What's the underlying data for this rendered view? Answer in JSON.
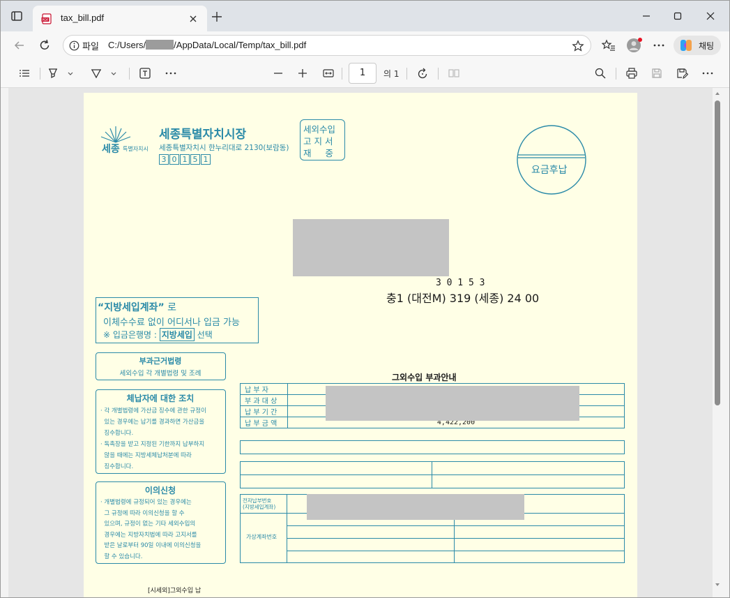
{
  "browser": {
    "tab_title": "tax_bill.pdf",
    "site_label": "파일",
    "url_prefix": "C:/Users/",
    "url_suffix": "/AppData/Local/Temp/tax_bill.pdf",
    "copilot_label": "채팅",
    "icons": [
      "tab-actions-icon",
      "pdf-file-icon",
      "close-icon",
      "plus-icon",
      "minimize-icon",
      "maximize-icon",
      "back-arrow-icon",
      "refresh-icon",
      "info-icon",
      "star-icon",
      "favorites-icon",
      "profile-icon",
      "more-icon",
      "copilot-icon"
    ]
  },
  "pdf_toolbar": {
    "page_number": "1",
    "page_total": "의 1",
    "icons": [
      "contents-icon",
      "highlight-icon",
      "draw-icon",
      "text-icon",
      "more-icon",
      "zoom-out-icon",
      "zoom-in-icon",
      "fit-width-icon",
      "rotate-icon",
      "two-page-icon",
      "search-icon",
      "print-icon",
      "save-icon",
      "save-as-icon",
      "more-icon"
    ]
  },
  "document": {
    "authority": {
      "logo_text": "세종",
      "logo_small": "특별자치시",
      "name": "세종특별자치시장",
      "address": "세종특별자치시 한누리대로 2130(보람동)",
      "postal_digits": [
        "3",
        "0",
        "1",
        "5",
        "1"
      ]
    },
    "stamp_lines": [
      "세외수입",
      "고 지 서",
      "재     중"
    ],
    "postage": "요금후납",
    "recipient": {
      "postal": "3 0 1 5 3",
      "address_line": "충1 (대전M) 319 (세종) 24 00"
    },
    "notice_account": {
      "line1_quote": "“지방세입계좌”",
      "line1_suffix": " 로",
      "line2": "이체수수료 없이 어디서나 입금 가능",
      "line3_prefix": "※ 입금은행명 :",
      "line3_box": "지방세입",
      "line3_suffix": "선택"
    },
    "legal_basis": {
      "title": "부과근거법령",
      "body": "세외수입 각 개별법령 및 조례"
    },
    "delinquent": {
      "title": "체납자에 대한 조치",
      "lines": [
        "· 각 개별법령에 가산금 징수에 관한 규정이",
        "  있는 경우에는 납기를 경과하면 가산금을",
        "  징수합니다.",
        "· 독촉장을 받고 지정된 기한까지 납부하지",
        "  않을 때에는 지방세체납처분에 따라",
        "  징수합니다."
      ]
    },
    "objection": {
      "title": "이의신청",
      "lines": [
        "· 개별법령에 규정되어 있는 경우에는",
        "  그 규정에 따라 이의신청을 할 수",
        "  있으며, 규정이 없는 기타 세외수입의",
        "  경우에는 지방자치법에 따라 고지서를",
        "  받은 날로부터 90일 이내에 이의신청을",
        "  할 수 있습니다."
      ]
    },
    "bill": {
      "title": "그외수입 부과안내",
      "rows": [
        {
          "label": "납  부  자",
          "value": ""
        },
        {
          "label": "부 과 대 상",
          "value": ""
        },
        {
          "label": "납 부 기 간",
          "value": ""
        },
        {
          "label": "납 부 금 액",
          "value": "4,422,200"
        }
      ],
      "epay_label_1": "전자납부번호",
      "epay_label_2": "(지방세입계좌)",
      "virtual_label": "가상계좌번호"
    },
    "footer_cut": "[시세외]그외수입 납"
  }
}
